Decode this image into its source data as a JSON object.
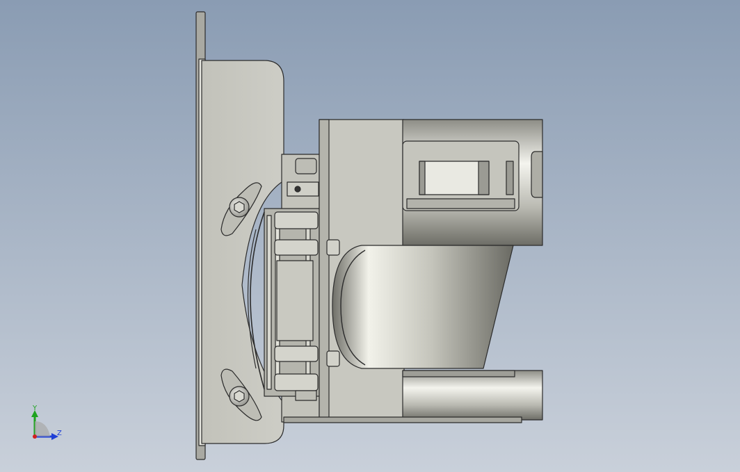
{
  "viewport": {
    "background_top": "#8a9cb3",
    "background_bottom": "#c9d0da",
    "part_fill": "#c9c9c2",
    "part_stroke": "#2b2b2b"
  },
  "triad": {
    "y_label": "Y",
    "z_label": "Z",
    "y_color": "#1fa31f",
    "z_color": "#1f3fd6",
    "origin_color": "#d01f1f"
  }
}
